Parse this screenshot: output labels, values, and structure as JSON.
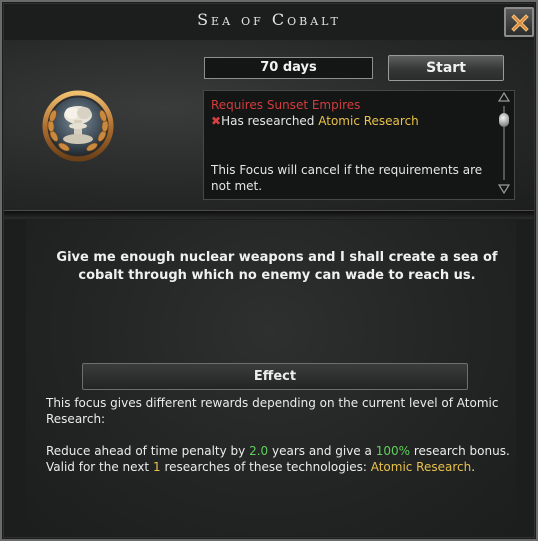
{
  "window": {
    "title": "Sea of Cobalt",
    "close_icon": "close-x-icon"
  },
  "focus": {
    "icon": "nuclear-mushroom-cloud-laurel-icon",
    "duration": "70 days",
    "start_label": "Start"
  },
  "requirements": {
    "header": "Requires Sunset Empires",
    "mark_icon": "red-x-icon",
    "mark_glyph": "✖",
    "item_prefix": "Has researched",
    "item_tech": "Atomic Research",
    "warning": "This Focus will cancel if the requirements are not met."
  },
  "description": "Give me enough nuclear weapons and I shall create a sea of cobalt through which no enemy can wade to reach us.",
  "effect": {
    "label": "Effect",
    "line1": "This focus gives different rewards depending on the current level of Atomic Research:",
    "line2_a": "Reduce ahead of time penalty by",
    "line2_years": "2.0",
    "line2_b": "years and give a",
    "line2_bonus": "100%",
    "line2_c": "research bonus.",
    "line3_a": "Valid for the next",
    "line3_count": "1",
    "line3_b": "researches of these technologies:",
    "line3_tech": "Atomic Research",
    "line3_end": "."
  },
  "colors": {
    "requirement_red": "#d43c3c",
    "tech_gold": "#e8c24a",
    "value_green": "#5fd05a"
  }
}
